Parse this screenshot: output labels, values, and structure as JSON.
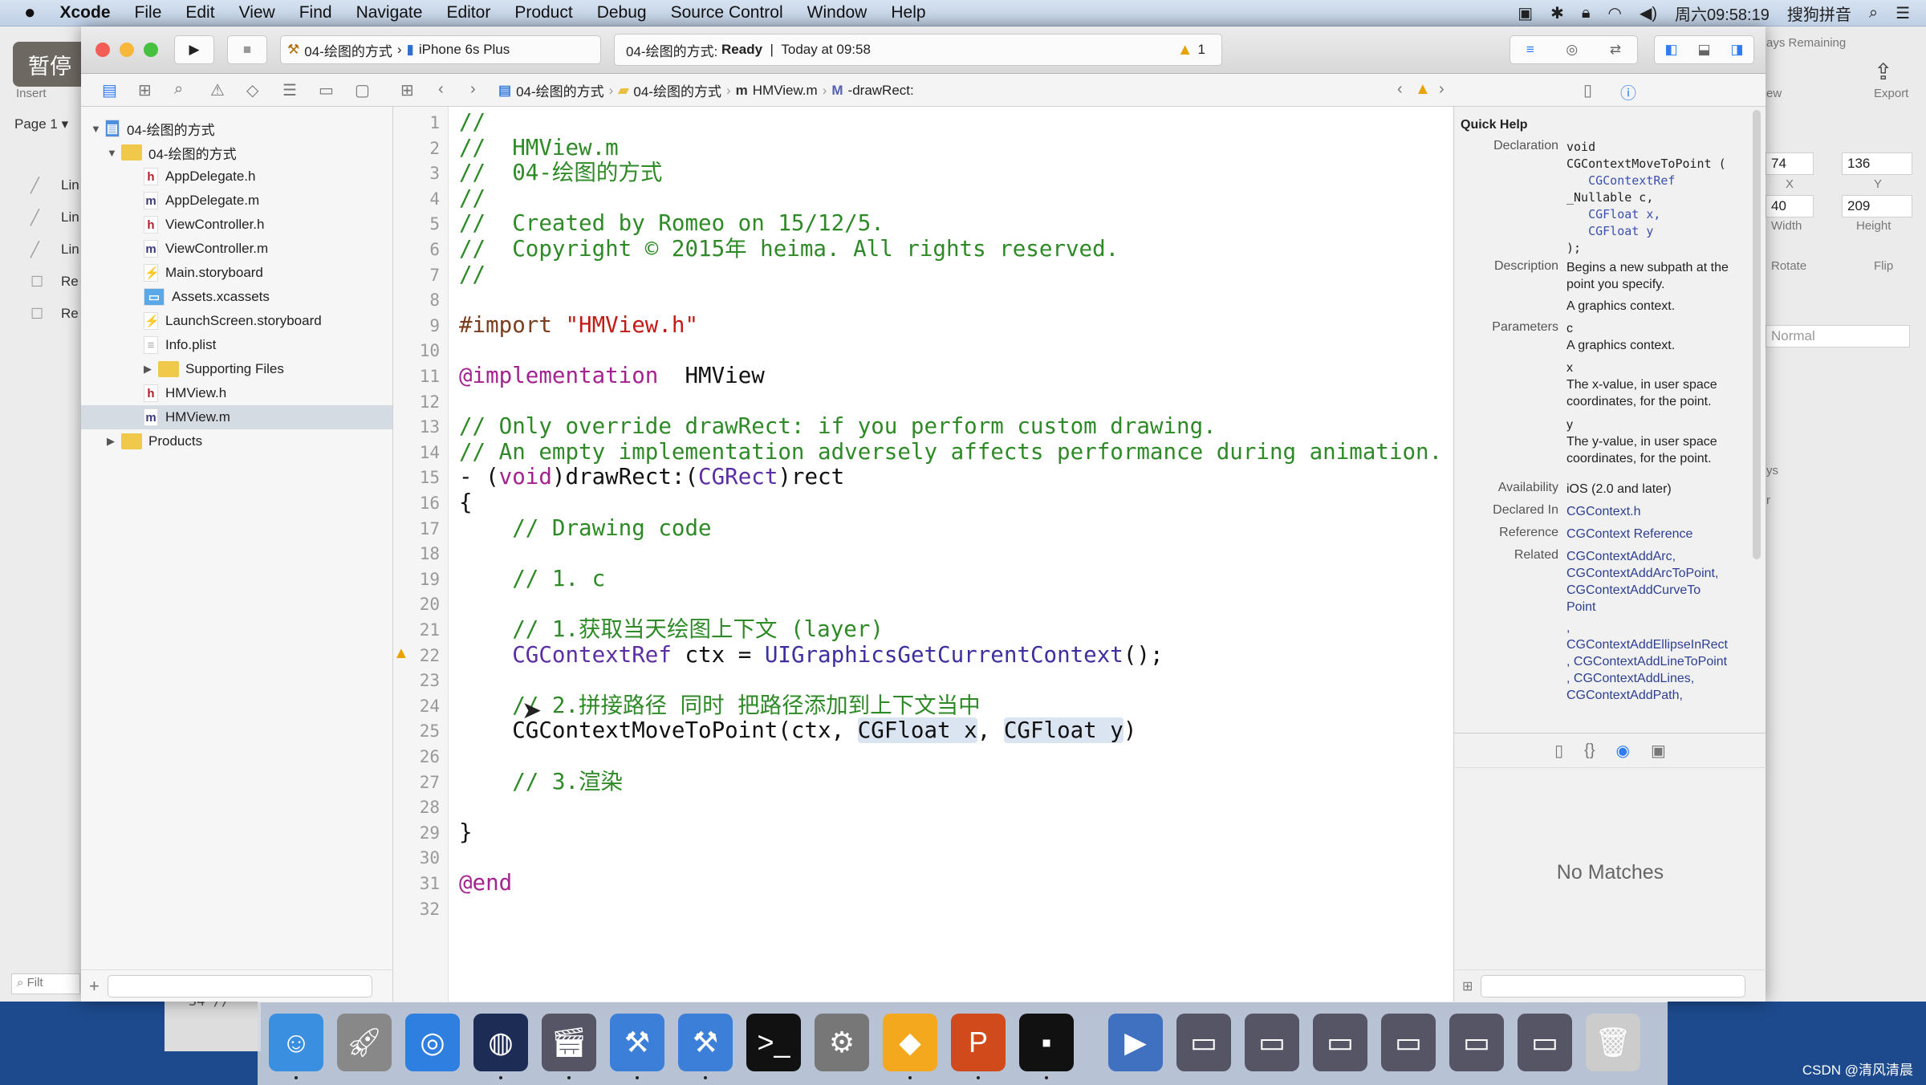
{
  "menubar": {
    "apple": "",
    "app": "Xcode",
    "items": [
      "File",
      "Edit",
      "View",
      "Find",
      "Navigate",
      "Editor",
      "Product",
      "Debug",
      "Source Control",
      "Window",
      "Help"
    ],
    "clock": "周六09:58:19",
    "ime": "搜狗拼音"
  },
  "overlay": {
    "pause": "暂停"
  },
  "sketch_left": {
    "insert": "Insert",
    "page": "Page 1 ▾",
    "layers": [
      "Lin",
      "Lin",
      "Lin",
      "Re",
      "Re"
    ],
    "filter": "Filt"
  },
  "sketch_right": {
    "trial": "ays Remaining",
    "view": "ew",
    "export": "Export",
    "x": "74",
    "y": "136",
    "x_label": "X",
    "y_label": "Y",
    "width": "40",
    "height": "209",
    "width_label": "Width",
    "height_label": "Height",
    "rotate": "Rotate",
    "flip": "Flip",
    "blend": "Normal",
    "misc1": "ys",
    "misc2": "r"
  },
  "behind_window": {
    "text": "34  //"
  },
  "toolbar": {
    "scheme": "04-绘图的方式",
    "device": "iPhone 6s Plus",
    "status_project": "04-绘图的方式:",
    "status_state": "Ready",
    "status_sep": "|",
    "status_time": "Today at 09:58",
    "warnings": "1"
  },
  "jumpbar": [
    "04-绘图的方式",
    "04-绘图的方式",
    "HMView.m",
    "-drawRect:"
  ],
  "navigator": {
    "items": [
      {
        "label": "04-绘图的方式",
        "kind": "project",
        "indent": 0,
        "disclosure": "▼"
      },
      {
        "label": "04-绘图的方式",
        "kind": "folder",
        "indent": 1,
        "disclosure": "▼"
      },
      {
        "label": "AppDelegate.h",
        "kind": "h",
        "indent": 2
      },
      {
        "label": "AppDelegate.m",
        "kind": "m",
        "indent": 2
      },
      {
        "label": "ViewController.h",
        "kind": "h",
        "indent": 2
      },
      {
        "label": "ViewController.m",
        "kind": "m",
        "indent": 2
      },
      {
        "label": "Main.storyboard",
        "kind": "sb",
        "indent": 2
      },
      {
        "label": "Assets.xcassets",
        "kind": "assets",
        "indent": 2
      },
      {
        "label": "LaunchScreen.storyboard",
        "kind": "sb",
        "indent": 2
      },
      {
        "label": "Info.plist",
        "kind": "plist",
        "indent": 2
      },
      {
        "label": "Supporting Files",
        "kind": "folder",
        "indent": 2,
        "disclosure": "▶"
      },
      {
        "label": "HMView.h",
        "kind": "h",
        "indent": 2
      },
      {
        "label": "HMView.m",
        "kind": "m",
        "indent": 2,
        "selected": true
      },
      {
        "label": "Products",
        "kind": "folder",
        "indent": 1,
        "disclosure": "▶"
      }
    ]
  },
  "editor": {
    "warning_line": 22,
    "lines": [
      [
        [
          "cm",
          "//"
        ]
      ],
      [
        [
          "cm",
          "//  HMView.m"
        ]
      ],
      [
        [
          "cm",
          "//  04-绘图的方式"
        ]
      ],
      [
        [
          "cm",
          "//"
        ]
      ],
      [
        [
          "cm",
          "//  Created by Romeo on 15/12/5."
        ]
      ],
      [
        [
          "cm",
          "//  Copyright © 2015年 heima. All rights reserved."
        ]
      ],
      [
        [
          "cm",
          "//"
        ]
      ],
      [],
      [
        [
          "pre",
          "#import "
        ],
        [
          "str",
          "\"HMView.h\""
        ]
      ],
      [],
      [
        [
          "kw",
          "@implementation"
        ],
        [
          "",
          "  HMView"
        ]
      ],
      [],
      [
        [
          "cm",
          "// Only override drawRect: if you perform custom drawing."
        ]
      ],
      [
        [
          "cm",
          "// An empty implementation adversely affects performance during animation."
        ]
      ],
      [
        [
          "",
          "- ("
        ],
        [
          "kw",
          "void"
        ],
        [
          "",
          ")drawRect:("
        ],
        [
          "type",
          "CGRect"
        ],
        [
          "",
          ")rect"
        ]
      ],
      [
        [
          "",
          "{"
        ]
      ],
      [
        [
          "",
          "    "
        ],
        [
          "cm",
          "// Drawing code"
        ]
      ],
      [],
      [
        [
          "",
          "    "
        ],
        [
          "cm",
          "// 1. c"
        ]
      ],
      [],
      [
        [
          "",
          "    "
        ],
        [
          "cm",
          "// 1.获取当天绘图上下文 (layer)"
        ]
      ],
      [
        [
          "",
          "    "
        ],
        [
          "type",
          "CGContextRef"
        ],
        [
          "",
          " ctx = "
        ],
        [
          "fn",
          "UIGraphicsGetCurrentContext"
        ],
        [
          "",
          "();"
        ]
      ],
      [],
      [
        [
          "",
          "    "
        ],
        [
          "cm",
          "// 2.拼接路径 同时 把路径添加到上下文当中"
        ]
      ],
      [
        [
          "",
          "    CGContextMoveToPoint(ctx, "
        ],
        [
          "ph",
          "CGFloat x"
        ],
        [
          "",
          ", "
        ],
        [
          "ph",
          "CGFloat y"
        ],
        [
          "",
          ")"
        ]
      ],
      [],
      [
        [
          "",
          "    "
        ],
        [
          "cm",
          "// 3.渲染"
        ]
      ],
      [],
      [
        [
          "",
          "}"
        ]
      ],
      [],
      [
        [
          "kw",
          "@end"
        ]
      ],
      []
    ]
  },
  "quick_help": {
    "title": "Quick Help",
    "declaration_label": "Declaration",
    "declaration": [
      "void",
      "CGContextMoveToPoint (",
      "   CGContextRef",
      "_Nullable c,",
      "   CGFloat x,",
      "   CGFloat y",
      ");"
    ],
    "description_label": "Description",
    "description": "Begins a new subpath at the point you specify.",
    "description2": "A graphics context.",
    "parameters_label": "Parameters",
    "params": [
      {
        "name": "c",
        "desc": "A graphics context."
      },
      {
        "name": "x",
        "desc": "The x-value, in user space coordinates, for the point."
      },
      {
        "name": "y",
        "desc": "The y-value, in user space coordinates, for the point."
      }
    ],
    "availability_label": "Availability",
    "availability": "iOS (2.0 and later)",
    "declared_label": "Declared In",
    "declared": "CGContext.h",
    "reference_label": "Reference",
    "reference": "CGContext Reference",
    "related_label": "Related",
    "related": [
      "CGContextAddArc,",
      "CGContextAddArcToPoint,",
      "CGContextAddCurveTo",
      "Point",
      ",",
      "CGContextAddEllipseInRect",
      ", CGContextAddLineToPoint",
      ", CGContextAddLines,",
      "CGContextAddPath,"
    ]
  },
  "library": {
    "empty": "No Matches"
  },
  "colors": {
    "accent": "#2e7cf6",
    "comment": "#2e8a26",
    "keyword": "#a3238f",
    "string": "#c41a16",
    "type": "#5c2ea3",
    "desktop": "#1d4a8c"
  },
  "dock": {
    "apps": [
      "finder",
      "launchpad",
      "safari",
      "mouse",
      "photo-booth",
      "xcode",
      "instruments",
      "terminal",
      "system-preferences",
      "sketch",
      "powerpoint",
      "exec",
      "quicktime",
      "screen1",
      "screen2",
      "screen3",
      "screen4",
      "screen5",
      "screen6",
      "trash"
    ]
  },
  "watermark": "CSDN @清风清晨"
}
